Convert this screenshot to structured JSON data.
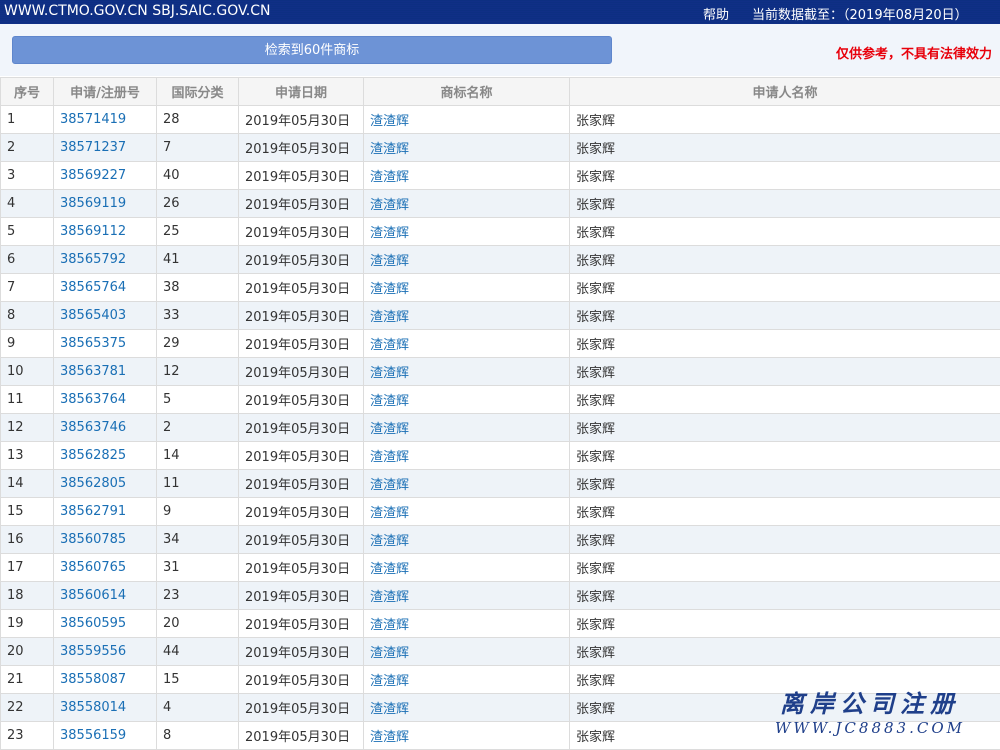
{
  "header": {
    "site": "WWW.CTMO.GOV.CN SBJ.SAIC.GOV.CN",
    "help": "帮助",
    "data_as_of": "当前数据截至：（2019年08月20日）"
  },
  "toolbar": {
    "result_label": "检索到60件商标",
    "disclaimer": "仅供参考，不具有法律效力"
  },
  "table": {
    "columns": [
      "序号",
      "申请/注册号",
      "国际分类",
      "申请日期",
      "商标名称",
      "申请人名称"
    ],
    "rows": [
      [
        "1",
        "38571419",
        "28",
        "2019年05月30日",
        "渣渣辉",
        "张家辉"
      ],
      [
        "2",
        "38571237",
        "7",
        "2019年05月30日",
        "渣渣辉",
        "张家辉"
      ],
      [
        "3",
        "38569227",
        "40",
        "2019年05月30日",
        "渣渣辉",
        "张家辉"
      ],
      [
        "4",
        "38569119",
        "26",
        "2019年05月30日",
        "渣渣辉",
        "张家辉"
      ],
      [
        "5",
        "38569112",
        "25",
        "2019年05月30日",
        "渣渣辉",
        "张家辉"
      ],
      [
        "6",
        "38565792",
        "41",
        "2019年05月30日",
        "渣渣辉",
        "张家辉"
      ],
      [
        "7",
        "38565764",
        "38",
        "2019年05月30日",
        "渣渣辉",
        "张家辉"
      ],
      [
        "8",
        "38565403",
        "33",
        "2019年05月30日",
        "渣渣辉",
        "张家辉"
      ],
      [
        "9",
        "38565375",
        "29",
        "2019年05月30日",
        "渣渣辉",
        "张家辉"
      ],
      [
        "10",
        "38563781",
        "12",
        "2019年05月30日",
        "渣渣辉",
        "张家辉"
      ],
      [
        "11",
        "38563764",
        "5",
        "2019年05月30日",
        "渣渣辉",
        "张家辉"
      ],
      [
        "12",
        "38563746",
        "2",
        "2019年05月30日",
        "渣渣辉",
        "张家辉"
      ],
      [
        "13",
        "38562825",
        "14",
        "2019年05月30日",
        "渣渣辉",
        "张家辉"
      ],
      [
        "14",
        "38562805",
        "11",
        "2019年05月30日",
        "渣渣辉",
        "张家辉"
      ],
      [
        "15",
        "38562791",
        "9",
        "2019年05月30日",
        "渣渣辉",
        "张家辉"
      ],
      [
        "16",
        "38560785",
        "34",
        "2019年05月30日",
        "渣渣辉",
        "张家辉"
      ],
      [
        "17",
        "38560765",
        "31",
        "2019年05月30日",
        "渣渣辉",
        "张家辉"
      ],
      [
        "18",
        "38560614",
        "23",
        "2019年05月30日",
        "渣渣辉",
        "张家辉"
      ],
      [
        "19",
        "38560595",
        "20",
        "2019年05月30日",
        "渣渣辉",
        "张家辉"
      ],
      [
        "20",
        "38559556",
        "44",
        "2019年05月30日",
        "渣渣辉",
        "张家辉"
      ],
      [
        "21",
        "38558087",
        "15",
        "2019年05月30日",
        "渣渣辉",
        "张家辉"
      ],
      [
        "22",
        "38558014",
        "4",
        "2019年05月30日",
        "渣渣辉",
        "张家辉"
      ],
      [
        "23",
        "38556159",
        "8",
        "2019年05月30日",
        "渣渣辉",
        "张家辉"
      ]
    ]
  },
  "watermark": {
    "title": "离岸公司注册",
    "url": "WWW.JC8883.COM"
  },
  "colors": {
    "topbar": "#102f86",
    "button": "#6d93d6",
    "link": "#1a6fb5",
    "disclaimer": "#e8000b",
    "row_alt": "#eef3f8"
  }
}
